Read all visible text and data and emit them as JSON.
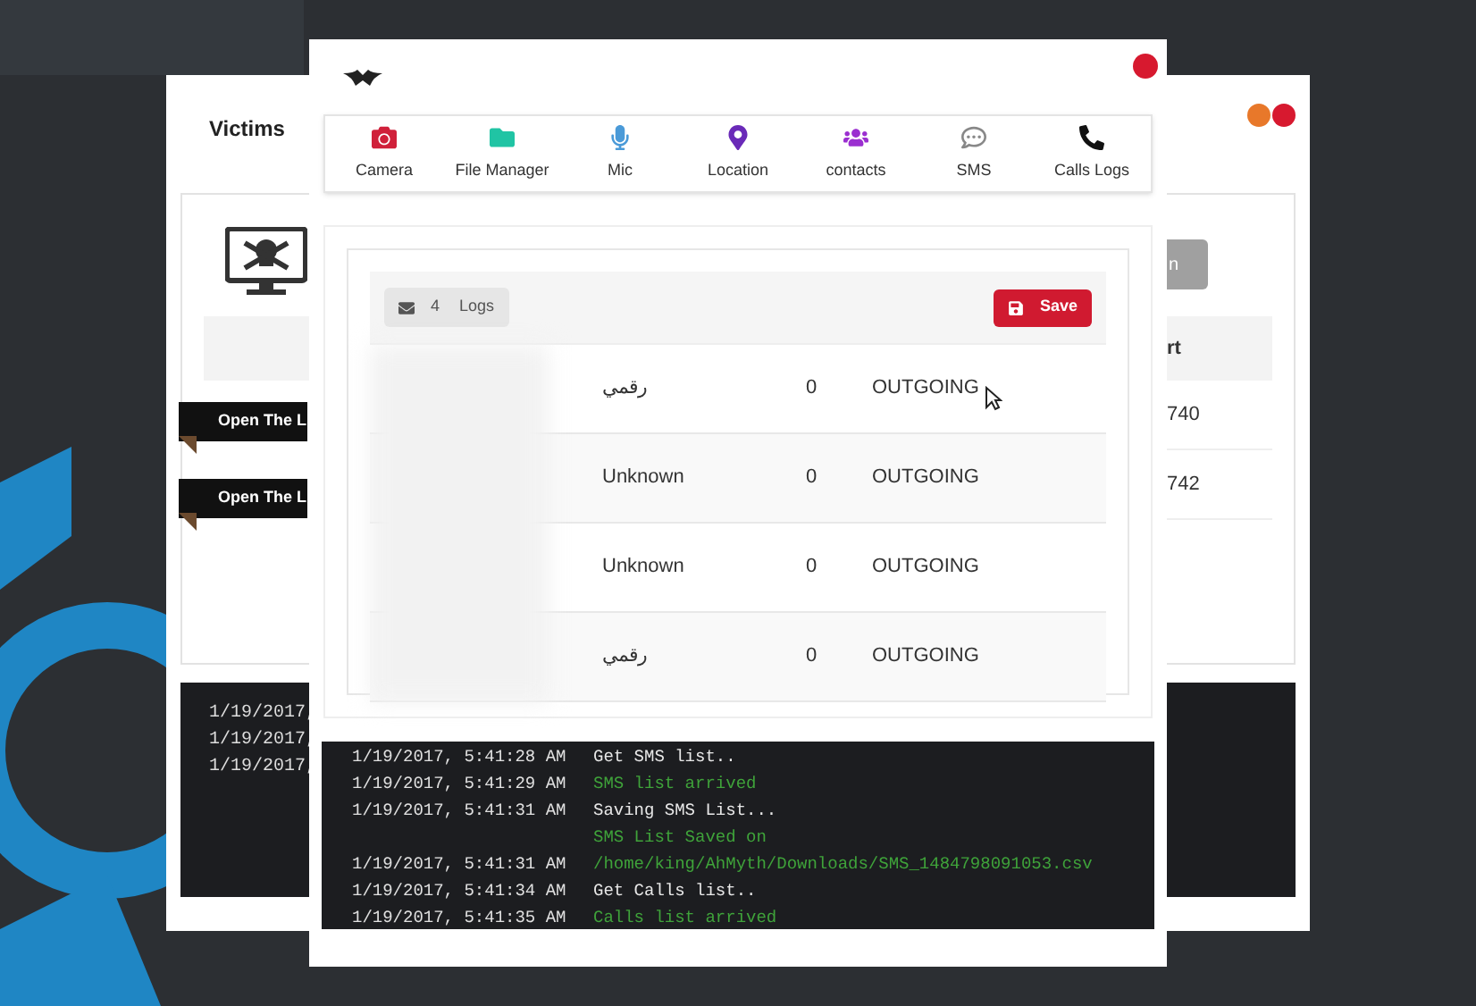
{
  "back_window": {
    "title": "Victims",
    "window_dots": [
      {
        "color": "#e8782a"
      },
      {
        "color": "#d7192f"
      }
    ],
    "button": "n",
    "column_header": "rt",
    "rows": [
      {
        "label": "Open The L",
        "port": "740"
      },
      {
        "label": "Open The L",
        "port": "742"
      }
    ],
    "log_lines": [
      "1/19/2017,",
      "1/19/2017,",
      "1/19/2017,"
    ]
  },
  "front_window": {
    "close_dot": {
      "color": "#d7192f"
    },
    "toolbar": [
      {
        "label": "Camera",
        "kind": "camera",
        "color": "#d0203a"
      },
      {
        "label": "File Manager",
        "kind": "folder",
        "color": "#20c4a4"
      },
      {
        "label": "Mic",
        "kind": "mic",
        "color": "#4a9ad8"
      },
      {
        "label": "Location",
        "kind": "pin",
        "color": "#6a2ab8"
      },
      {
        "label": "contacts",
        "kind": "users",
        "color": "#9b2fd0"
      },
      {
        "label": "SMS",
        "kind": "chat",
        "color": "#888888"
      },
      {
        "label": "Calls Logs",
        "kind": "phone",
        "color": "#111111"
      }
    ],
    "logs_badge": {
      "count": "4",
      "label": "Logs"
    },
    "save_button": "Save",
    "calls": [
      {
        "name": "رقمي",
        "duration": "0",
        "type": "OUTGOING"
      },
      {
        "name": "Unknown",
        "duration": "0",
        "type": "OUTGOING"
      },
      {
        "name": "Unknown",
        "duration": "0",
        "type": "OUTGOING"
      },
      {
        "name": "رقمي",
        "duration": "0",
        "type": "OUTGOING"
      }
    ],
    "console": [
      {
        "time": "1/19/2017, 5:41:28 AM",
        "message": "Get SMS list..",
        "kind": "command"
      },
      {
        "time": "1/19/2017, 5:41:29 AM",
        "message": "SMS list arrived",
        "kind": "result"
      },
      {
        "time": "1/19/2017, 5:41:31 AM",
        "message": "Saving SMS List...",
        "kind": "command"
      },
      {
        "message": "SMS List Saved on",
        "kind": "result"
      },
      {
        "time": "1/19/2017, 5:41:31 AM",
        "message": "/home/king/AhMyth/Downloads/SMS_1484798091053.csv",
        "kind": "result"
      },
      {
        "time": "1/19/2017, 5:41:34 AM",
        "message": "Get Calls list..",
        "kind": "command"
      },
      {
        "time": "1/19/2017, 5:41:35 AM",
        "message": "Calls list arrived",
        "kind": "result"
      }
    ]
  }
}
